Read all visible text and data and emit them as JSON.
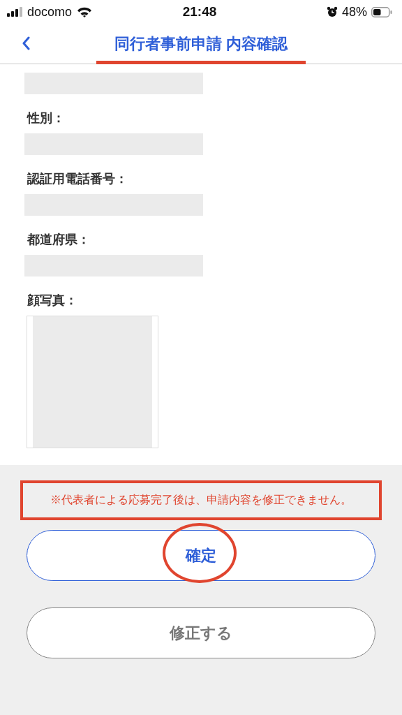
{
  "status_bar": {
    "carrier": "docomo",
    "time": "21:48",
    "battery": "48%"
  },
  "nav": {
    "title": "同行者事前申請 内容確認"
  },
  "fields": [
    {
      "kind": "text"
    },
    {
      "kind": "text",
      "label": "性別："
    },
    {
      "kind": "text",
      "label": "認証用電話番号："
    },
    {
      "kind": "text",
      "label": "都道府県："
    },
    {
      "kind": "photo",
      "label": "顔写真："
    }
  ],
  "notice": "※代表者による応募完了後は、申請内容を修正できません。",
  "buttons": [
    {
      "kind": "primary",
      "label": "確定"
    },
    {
      "kind": "secondary",
      "label": "修正する"
    }
  ],
  "annotations": {
    "title_underline": true,
    "notice_box": true,
    "button_circle": true
  }
}
